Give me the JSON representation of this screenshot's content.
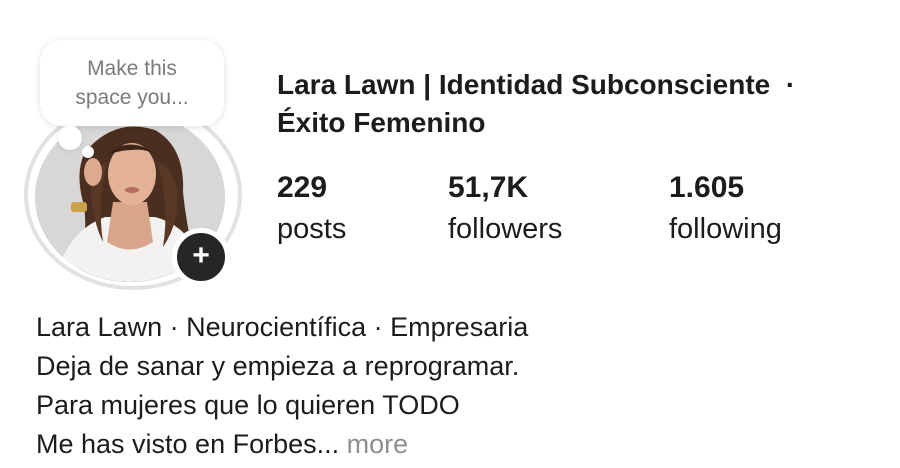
{
  "note": {
    "text": "Make this space you..."
  },
  "profile": {
    "name_line1": "Lara Lawn | Identidad Subconsciente  ·",
    "name_line2": "Éxito Femenino"
  },
  "stats": [
    {
      "value": "229",
      "label": "posts"
    },
    {
      "value": "51,7K",
      "label": "followers"
    },
    {
      "value": "1.605",
      "label": "following"
    }
  ],
  "bio": {
    "lines": [
      "Lara Lawn · Neurocientífica · Empresaria",
      "Deja de sanar y empieza a reprogramar.",
      "Para mujeres que lo quieren TODO",
      "Me has visto en Forbes..."
    ],
    "more_label": "more"
  },
  "icons": {
    "add_story": "plus-icon"
  },
  "colors": {
    "text": "#1c1c1e",
    "muted": "#8e8e93",
    "badge": "#262626",
    "ring": "#e2e2e4"
  }
}
